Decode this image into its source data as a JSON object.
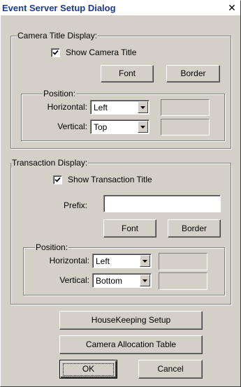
{
  "window": {
    "title": "Event Server Setup Dialog",
    "close_glyph": "✕"
  },
  "camera_title_display": {
    "legend": "Camera Title Display:",
    "show_checkbox_label": "Show Camera Title",
    "show_checked": true,
    "font_button": "Font",
    "border_button": "Border",
    "position": {
      "legend": "Position:",
      "horizontal_label": "Horizontal:",
      "horizontal_value": "Left",
      "vertical_label": "Vertical:",
      "vertical_value": "Top"
    }
  },
  "transaction_display": {
    "legend": "Transaction Display:",
    "show_checkbox_label": "Show Transaction Title",
    "show_checked": true,
    "prefix_label": "Prefix:",
    "prefix_value": "",
    "font_button": "Font",
    "border_button": "Border",
    "position": {
      "legend": "Position:",
      "horizontal_label": "Horizontal:",
      "horizontal_value": "Left",
      "vertical_label": "Vertical:",
      "vertical_value": "Bottom"
    }
  },
  "buttons": {
    "housekeeping": "HouseKeeping Setup",
    "camera_allocation": "Camera Allocation Table",
    "ok": "OK",
    "cancel": "Cancel"
  },
  "colors": {
    "dialog_face": "#d4d0c8",
    "title_text": "#1a3a8e"
  }
}
